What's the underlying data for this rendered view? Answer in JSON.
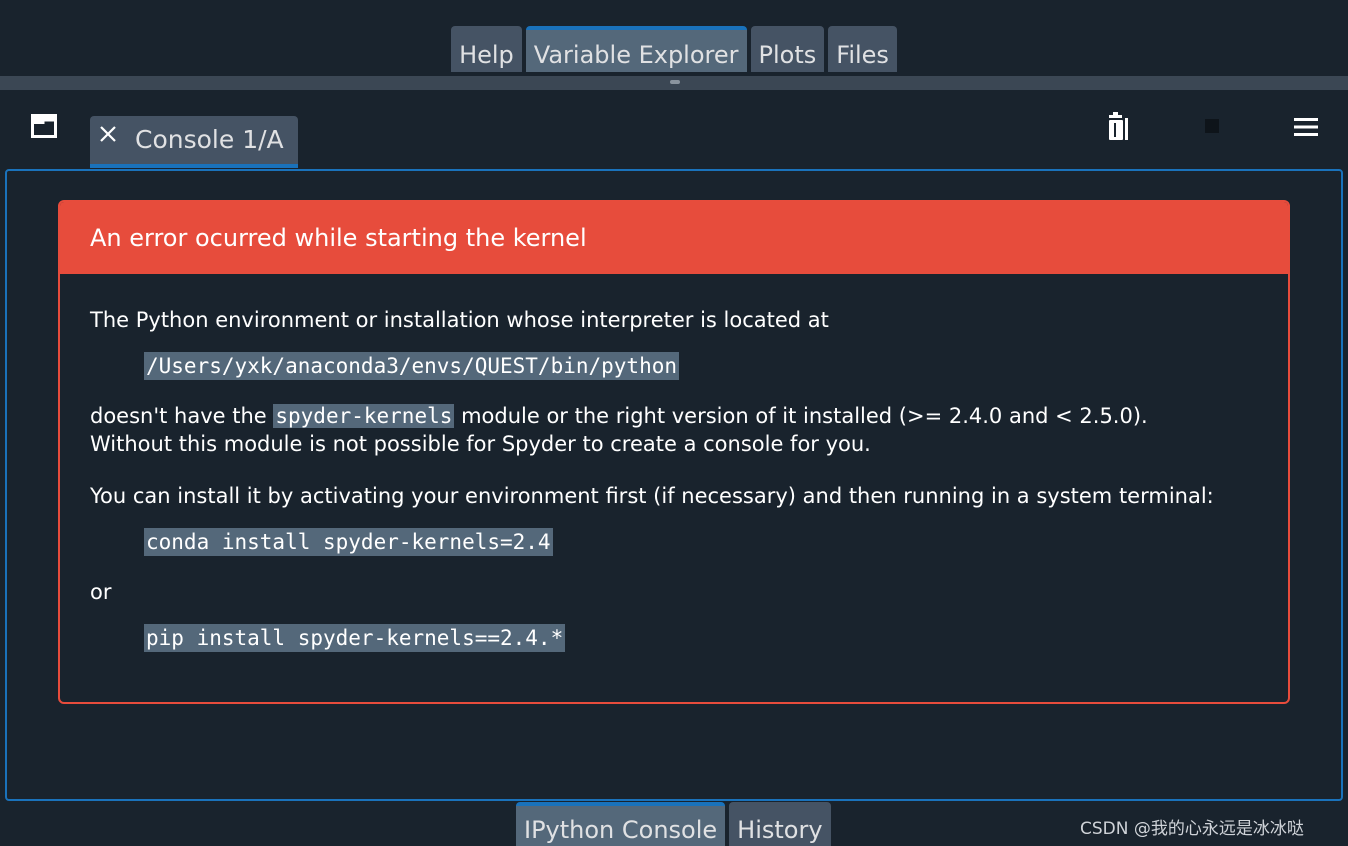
{
  "top_tabs": [
    {
      "label": "Help",
      "active": false
    },
    {
      "label": "Variable Explorer",
      "active": true
    },
    {
      "label": "Plots",
      "active": false
    },
    {
      "label": "Files",
      "active": false
    }
  ],
  "console": {
    "tab_label": "Console 1/A"
  },
  "error": {
    "title": "An error ocurred while starting the kernel",
    "line1": "The Python environment or installation whose interpreter is located at",
    "interpreter_path": "/Users/yxk/anaconda3/envs/QUEST/bin/python",
    "line2_pre": "doesn't have the ",
    "line2_module": "spyder-kernels",
    "line2_post": " module or the right version of it installed (>= 2.4.0 and < 2.5.0).",
    "line3": "Without this module is not possible for Spyder to create a console for you.",
    "line4": "You can install it by activating your environment first (if necessary) and then running in a system terminal:",
    "conda_cmd": "conda install spyder-kernels=2.4",
    "or_text": "or",
    "pip_cmd": "pip install spyder-kernels==2.4.*"
  },
  "bottom_tabs": [
    {
      "label": "IPython Console",
      "active": true
    },
    {
      "label": "History",
      "active": false
    }
  ],
  "watermark": "CSDN @我的心永远是冰冰哒",
  "colors": {
    "background": "#19232d",
    "accent": "#1a72bb",
    "error": "#e74c3c",
    "tab": "#455364"
  }
}
